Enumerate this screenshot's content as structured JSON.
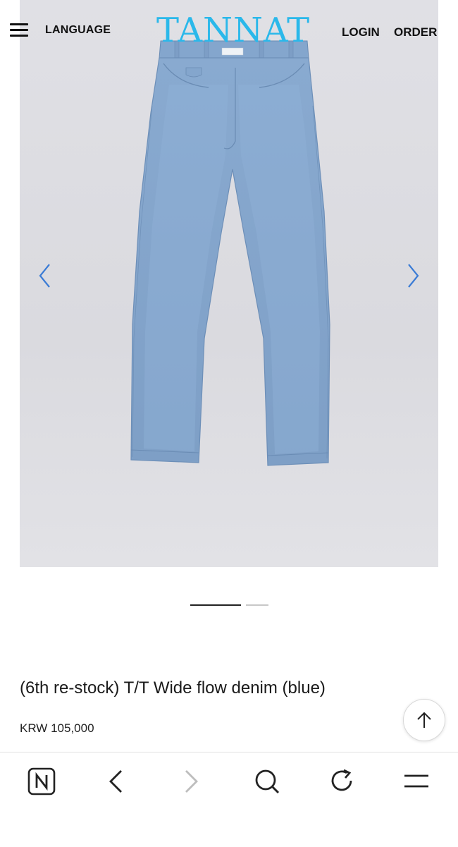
{
  "header": {
    "menu_icon": "hamburger-icon",
    "language_label": "LANGUAGE",
    "logo_text": "TANNAT",
    "login_label": "LOGIN",
    "order_label": "ORDER",
    "logo_color": "#2ab8ea"
  },
  "gallery": {
    "prev_icon": "chevron-left-icon",
    "next_icon": "chevron-right-icon",
    "arrow_color": "#3a7bd5",
    "slide_count": 2,
    "active_slide": 1
  },
  "product": {
    "title": "(6th re-stock) T/T Wide flow denim (blue)",
    "price": "KRW 105,000"
  },
  "scroll_top": {
    "icon": "arrow-up-icon"
  },
  "browser_bar": {
    "items": [
      "naver-home-icon",
      "back-icon",
      "forward-icon",
      "search-icon",
      "reload-icon",
      "menu-icon"
    ]
  }
}
